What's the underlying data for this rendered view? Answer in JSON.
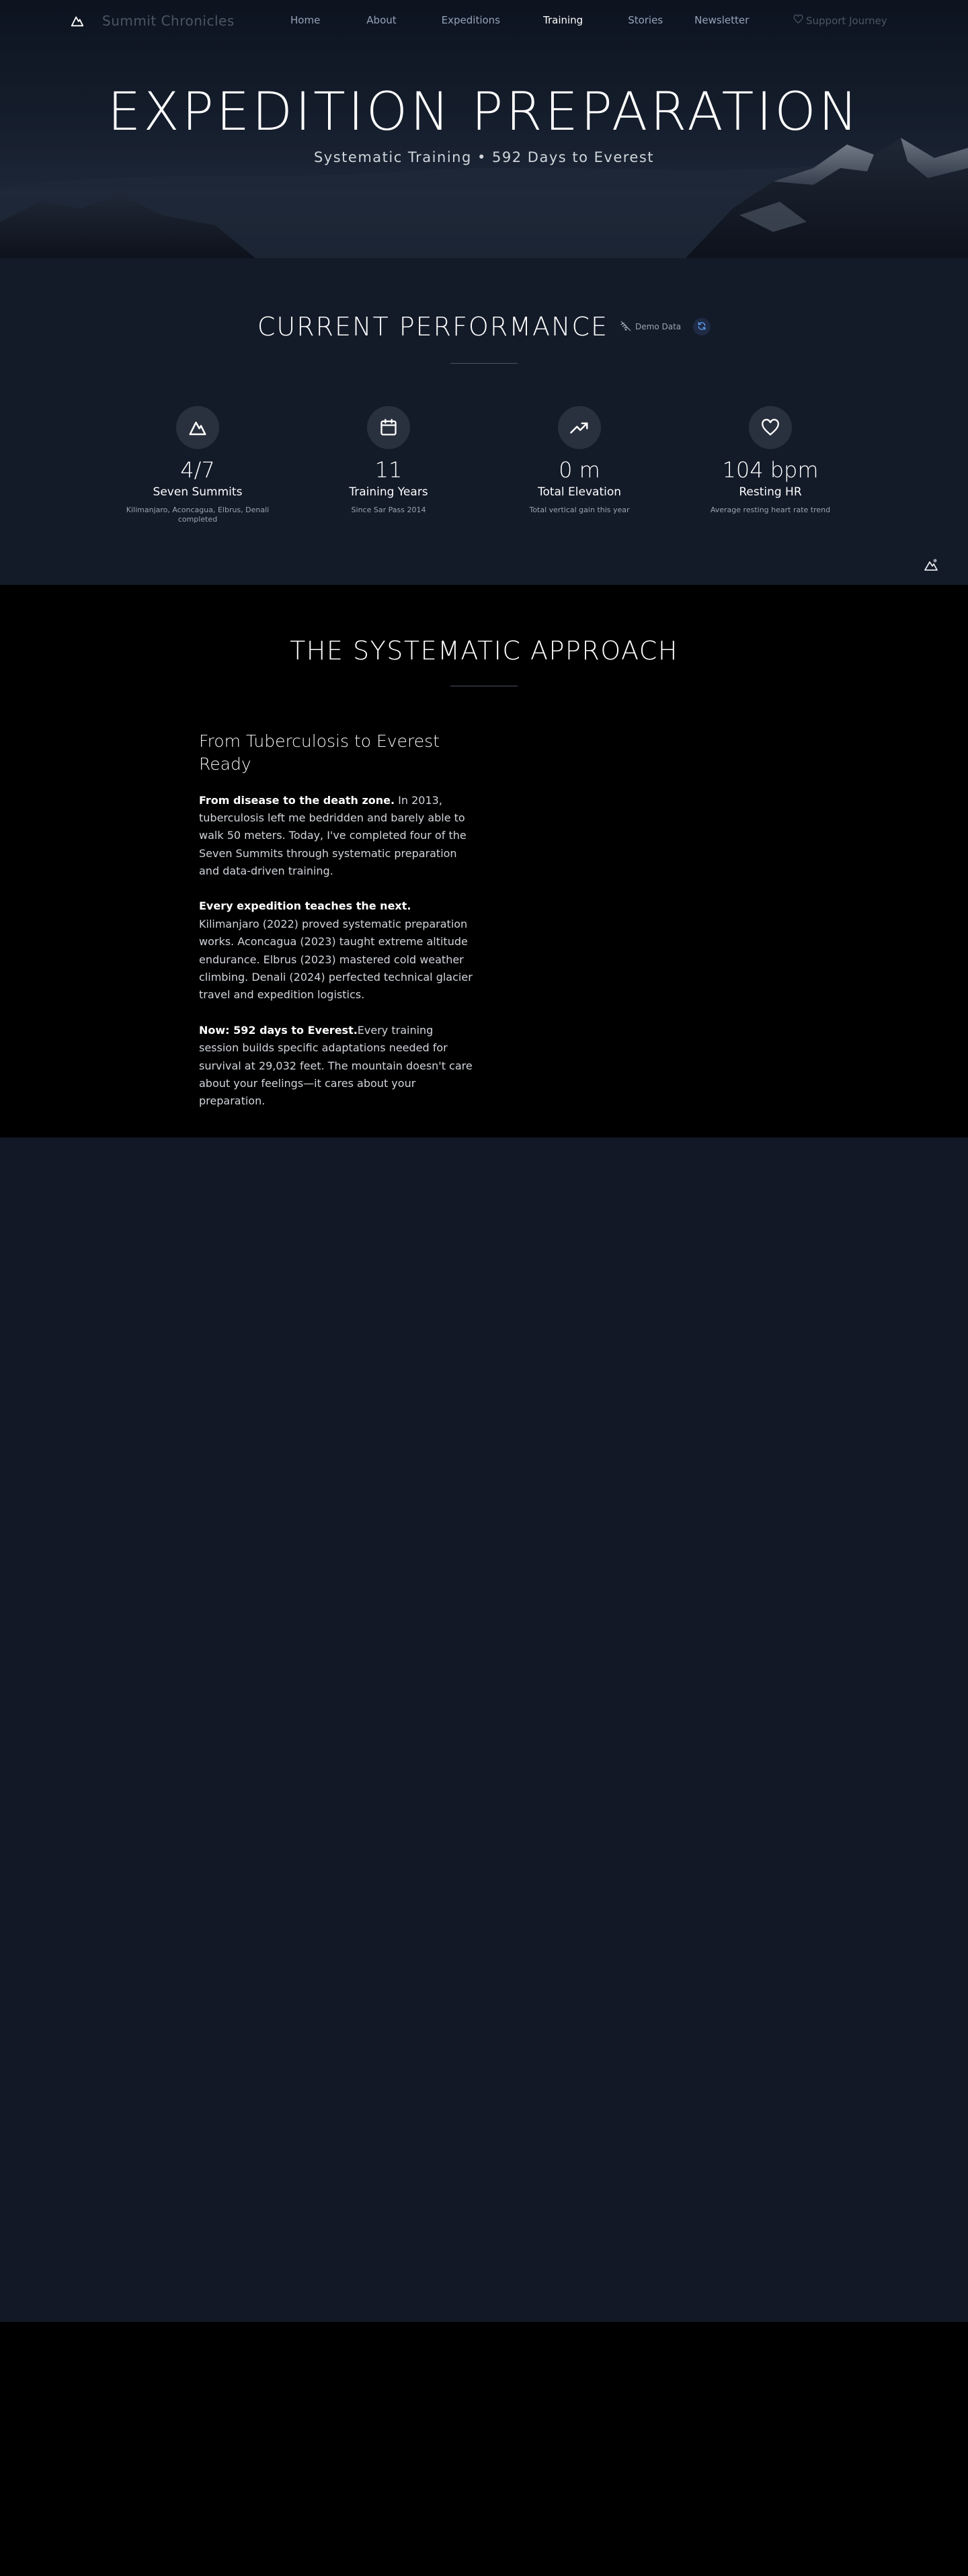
{
  "nav": {
    "brand": "Summit Chronicles",
    "links": [
      {
        "label": "Home",
        "active": false
      },
      {
        "label": "About",
        "active": false
      },
      {
        "label": "Expeditions",
        "active": false
      },
      {
        "label": "Training",
        "active": true
      },
      {
        "label": "Stories",
        "active": false
      },
      {
        "label": "Newsletter",
        "active": false
      }
    ],
    "support_label": "Support Journey",
    "logo_icon": "mountain-icon"
  },
  "hero": {
    "title": "EXPEDITION PREPARATION",
    "subtitle": "Systematic Training • 592 Days to Everest"
  },
  "performance": {
    "title": "CURRENT PERFORMANCE",
    "demo_label": "Demo Data",
    "stats": [
      {
        "icon": "mountain-icon",
        "value": "4/7",
        "label": "Seven Summits",
        "desc": "Kilimanjaro, Aconcagua, Elbrus, Denali completed"
      },
      {
        "icon": "calendar-icon",
        "value": "11",
        "label": "Training Years",
        "desc": "Since Sar Pass 2014"
      },
      {
        "icon": "trending-up-icon",
        "value": "0 m",
        "label": "Total Elevation",
        "desc": "Total vertical gain this year"
      },
      {
        "icon": "heart-icon",
        "value": "104 bpm",
        "label": "Resting HR",
        "desc": "Average resting heart rate trend"
      }
    ]
  },
  "approach": {
    "title": "THE SYSTEMATIC APPROACH",
    "heading": "From Tuberculosis to Everest Ready",
    "paragraphs": [
      {
        "lead": "From disease to the death zone.",
        "text": " In 2013, tuberculosis left me bedridden and barely able to walk 50 meters. Today, I've completed four of the Seven Summits through systematic preparation and data-driven training."
      },
      {
        "lead": "Every expedition teaches the next.",
        "text": " Kilimanjaro (2022) proved systematic preparation works. Aconcagua (2023) taught extreme altitude endurance. Elbrus (2023) mastered cold weather climbing. Denali (2024) perfected technical glacier travel and expedition logistics."
      },
      {
        "lead": "Now: 592 days to Everest.",
        "text": "Every training session builds specific adaptations needed for survival at 29,032 feet. The mountain doesn't care about your feelings—it cares about your preparation."
      }
    ]
  },
  "colors": {
    "hero_bg": "#1a2434",
    "perf_bg": "#131a28",
    "approach_bg": "#000000",
    "lower_bg": "#131826",
    "icon_circle": "#2a313e",
    "muted_text": "#9ca3af"
  }
}
